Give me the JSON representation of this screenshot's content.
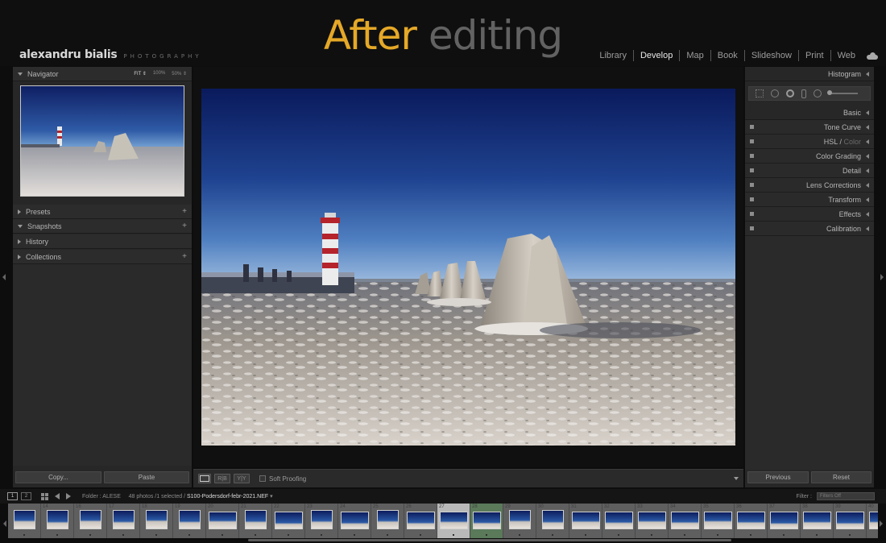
{
  "header": {
    "brand_name": "alexandru bialis",
    "brand_sub": "PHOTOGRAPHY",
    "headline_word1": "After",
    "headline_word2": "editing"
  },
  "modules": [
    {
      "label": "Library",
      "active": false
    },
    {
      "label": "Develop",
      "active": true
    },
    {
      "label": "Map",
      "active": false
    },
    {
      "label": "Book",
      "active": false
    },
    {
      "label": "Slideshow",
      "active": false
    },
    {
      "label": "Print",
      "active": false
    },
    {
      "label": "Web",
      "active": false
    }
  ],
  "left_panel": {
    "navigator": {
      "title": "Navigator",
      "zoom_fit": "FIT ⇕",
      "zoom_100": "100%",
      "zoom_50": "50% ⇕"
    },
    "sections": [
      {
        "title": "Presets",
        "expanded": false,
        "plus": true
      },
      {
        "title": "Snapshots",
        "expanded": true,
        "plus": true
      },
      {
        "title": "History",
        "expanded": false,
        "plus": false
      },
      {
        "title": "Collections",
        "expanded": false,
        "plus": true
      }
    ],
    "copy_label": "Copy...",
    "paste_label": "Paste"
  },
  "toolbar": {
    "compare_label": "R|B",
    "yy_label": "Y|Y",
    "soft_proofing_label": "Soft Proofing"
  },
  "right_panel": {
    "histogram_title": "Histogram",
    "basic_title": "Basic",
    "items": [
      {
        "label": "Tone Curve",
        "dim": ""
      },
      {
        "label": "HSL / ",
        "dim": "Color"
      },
      {
        "label": "Color Grading",
        "dim": ""
      },
      {
        "label": "Detail",
        "dim": ""
      },
      {
        "label": "Lens Corrections",
        "dim": ""
      },
      {
        "label": "Transform",
        "dim": ""
      },
      {
        "label": "Effects",
        "dim": ""
      },
      {
        "label": "Calibration",
        "dim": ""
      }
    ],
    "previous_label": "Previous",
    "reset_label": "Reset"
  },
  "filmstrip_bar": {
    "monitor1": "1",
    "monitor2": "2",
    "folder_text": "Folder : ALESE",
    "count_text": "48 photos /1 selected /",
    "filename": "S100-Podersdorf-febr-2021.NEF",
    "filter_label": "Filter :",
    "filter_value": "Filters Off"
  },
  "filmstrip": {
    "cells": [
      {
        "num": "",
        "wide": false,
        "state": ""
      },
      {
        "num": "14",
        "wide": false,
        "state": ""
      },
      {
        "num": "16",
        "wide": false,
        "state": ""
      },
      {
        "num": "17",
        "wide": false,
        "state": ""
      },
      {
        "num": "18",
        "wide": false,
        "state": ""
      },
      {
        "num": "19",
        "wide": false,
        "state": ""
      },
      {
        "num": "20",
        "wide": true,
        "state": ""
      },
      {
        "num": "21",
        "wide": false,
        "state": ""
      },
      {
        "num": "22",
        "wide": true,
        "state": ""
      },
      {
        "num": "23",
        "wide": false,
        "state": ""
      },
      {
        "num": "24",
        "wide": true,
        "state": ""
      },
      {
        "num": "25",
        "wide": false,
        "state": ""
      },
      {
        "num": "26",
        "wide": true,
        "state": ""
      },
      {
        "num": "27",
        "wide": true,
        "state": "selected"
      },
      {
        "num": "28",
        "wide": true,
        "state": "sibling"
      },
      {
        "num": "29",
        "wide": false,
        "state": ""
      },
      {
        "num": "30",
        "wide": false,
        "state": ""
      },
      {
        "num": "31",
        "wide": true,
        "state": ""
      },
      {
        "num": "32",
        "wide": true,
        "state": ""
      },
      {
        "num": "33",
        "wide": true,
        "state": ""
      },
      {
        "num": "34",
        "wide": true,
        "state": ""
      },
      {
        "num": "35",
        "wide": true,
        "state": ""
      },
      {
        "num": "36",
        "wide": true,
        "state": ""
      },
      {
        "num": "37",
        "wide": true,
        "state": ""
      },
      {
        "num": "38",
        "wide": true,
        "state": ""
      },
      {
        "num": "39",
        "wide": true,
        "state": ""
      },
      {
        "num": "40",
        "wide": true,
        "state": ""
      }
    ]
  }
}
